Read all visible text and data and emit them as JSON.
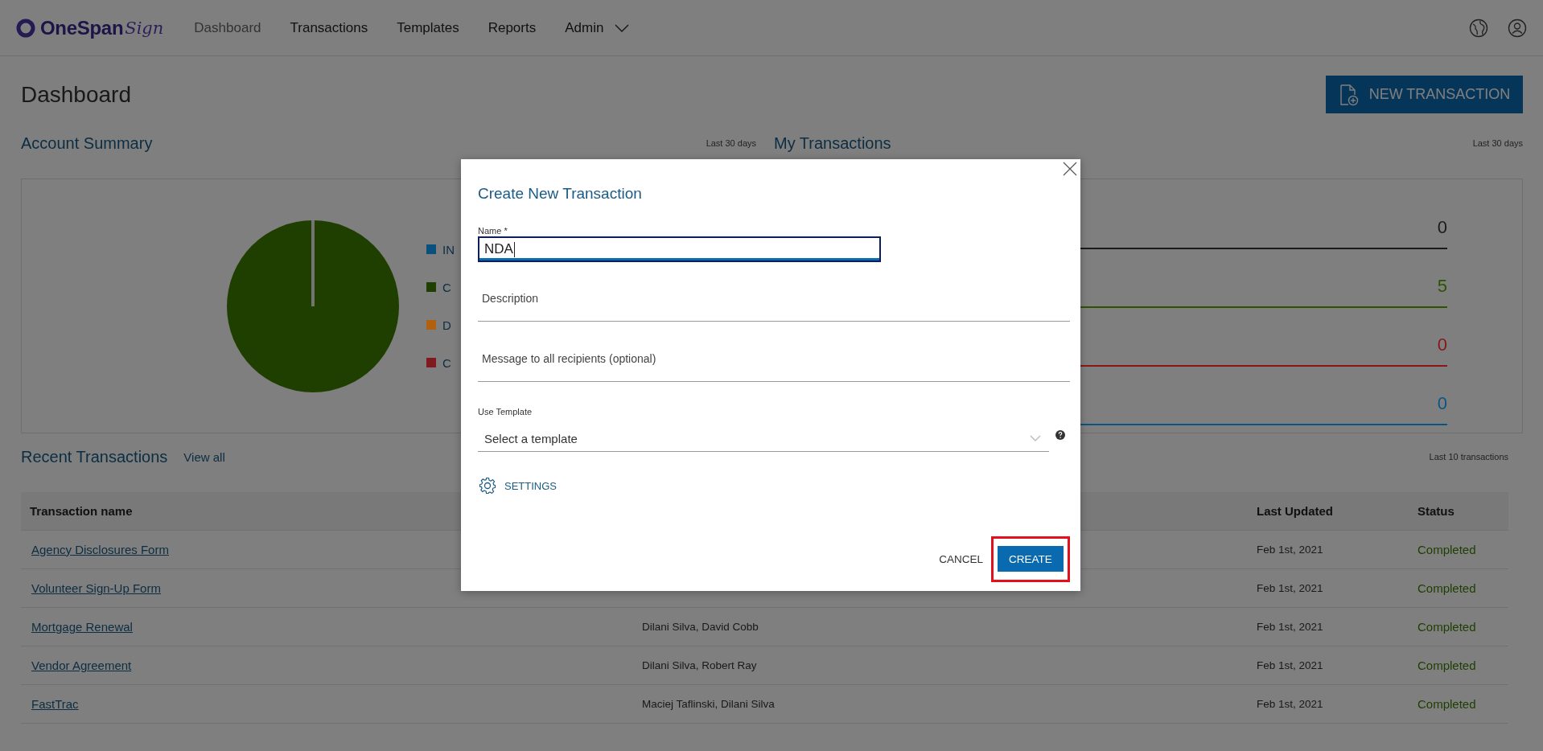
{
  "header": {
    "logo": {
      "brand": "OneSpan",
      "script": "Sign"
    },
    "nav": [
      {
        "label": "Dashboard",
        "kind": "link",
        "selected": true
      },
      {
        "label": "Transactions",
        "kind": "link",
        "selected": false
      },
      {
        "label": "Templates",
        "kind": "link",
        "selected": false
      },
      {
        "label": "Reports",
        "kind": "link",
        "selected": false
      },
      {
        "label": "Admin",
        "kind": "menu",
        "selected": false
      }
    ]
  },
  "page": {
    "title": "Dashboard",
    "new_button": "NEW TRANSACTION"
  },
  "account_summary": {
    "title": "Account Summary",
    "period": "Last 30 days",
    "legend": [
      {
        "label": "IN",
        "color": "#0a507f"
      },
      {
        "label": "C",
        "color": "#1f3f00"
      },
      {
        "label": "D",
        "color": "#b0600e"
      },
      {
        "label": "C",
        "color": "#801a1e"
      }
    ]
  },
  "my_transactions": {
    "title": "My Transactions",
    "period": "Last 30 days",
    "rows": [
      {
        "value": "0",
        "color": "#1a1a1a"
      },
      {
        "value": "5",
        "color": "#2f5200"
      },
      {
        "value": "0",
        "color": "#8a1717"
      },
      {
        "value": "0",
        "color": "#0a5585"
      }
    ]
  },
  "recent_transactions": {
    "title": "Recent Transactions",
    "view_all": "View all",
    "caption": "Last 10 transactions",
    "columns": {
      "name": "Transaction name",
      "updated": "Last Updated",
      "status": "Status"
    },
    "rows": [
      {
        "name": "Agency Disclosures Form",
        "updated": "Feb 1st, 2021",
        "status": "Completed"
      },
      {
        "name": "Volunteer Sign-Up Form",
        "updated": "Feb 1st, 2021",
        "status": "Completed"
      },
      {
        "name": "Mortgage Renewal",
        "recipients": "Dilani Silva, David Cobb",
        "updated": "Feb 1st, 2021",
        "status": "Completed"
      },
      {
        "name": "Vendor Agreement",
        "recipients": "Dilani Silva, Robert Ray",
        "updated": "Feb 1st, 2021",
        "status": "Completed"
      },
      {
        "name": "FastTrac",
        "recipients": "Maciej Taflinski, Dilani Silva",
        "updated": "Feb 1st, 2021",
        "status": "Completed"
      }
    ]
  },
  "modal": {
    "title": "Create New Transaction",
    "fields": [
      {
        "kind": "input",
        "label": "Name *",
        "value": "NDA",
        "focused": true
      },
      {
        "kind": "text",
        "placeholder": "Description"
      },
      {
        "kind": "text",
        "placeholder": "Message to all recipients (optional)"
      },
      {
        "kind": "select",
        "label": "Use Template",
        "placeholder": "Select a template"
      }
    ],
    "settings": "SETTINGS",
    "cancel": "CANCEL",
    "create": {
      "label": "CREATE",
      "highlighted": true
    }
  }
}
